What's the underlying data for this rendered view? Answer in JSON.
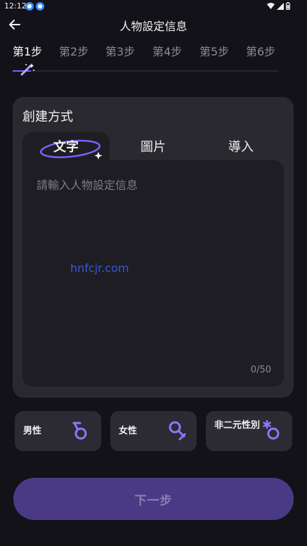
{
  "status_bar": {
    "time": "12:12"
  },
  "header": {
    "title": "人物設定信息"
  },
  "steps": [
    "第1步",
    "第2步",
    "第3步",
    "第4步",
    "第5步",
    "第6步"
  ],
  "active_step": 0,
  "step_progress": 0.07,
  "creation": {
    "title": "創建方式",
    "tabs": [
      "文字",
      "圖片",
      "導入"
    ],
    "active_tab": 0,
    "placeholder": "請輸入人物設定信息",
    "counter": "0/50",
    "watermark": "hnfcjr.com"
  },
  "genders": [
    "男性",
    "女性",
    "非二元性別"
  ],
  "next_label": "下一步",
  "colors": {
    "background": "#131218",
    "card": "#2a2930",
    "input": "#1e1d23",
    "accent": "#7a62ff",
    "button": "#4a3a86",
    "button_text": "#8b80b4"
  },
  "icons": {
    "back": "arrow-left-icon",
    "step_marker": "magic-wand-icon",
    "tab_highlight": "sparkle-ring-icon",
    "male": "male-symbol-icon",
    "female": "female-symbol-icon",
    "nonbinary": "nonbinary-symbol-icon"
  }
}
